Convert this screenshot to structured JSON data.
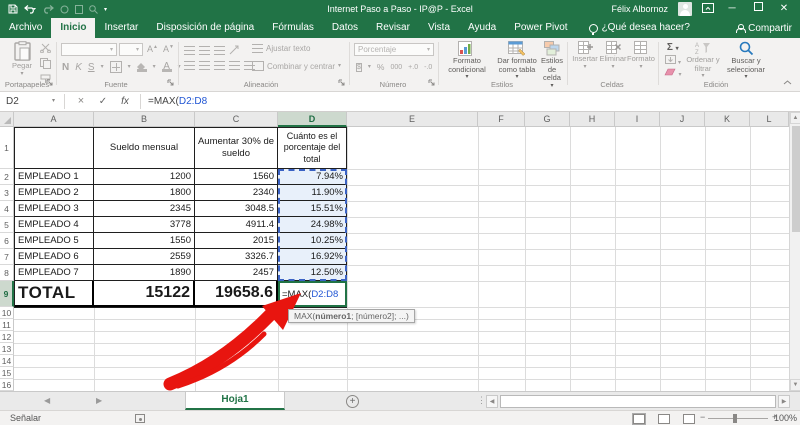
{
  "titlebar": {
    "title": "Internet Paso a Paso - IP@P - Excel",
    "user_name": "Félix Albornoz"
  },
  "tabs": [
    {
      "label": "Archivo",
      "active": false
    },
    {
      "label": "Inicio",
      "active": true
    },
    {
      "label": "Insertar",
      "active": false
    },
    {
      "label": "Disposición de página",
      "active": false
    },
    {
      "label": "Fórmulas",
      "active": false
    },
    {
      "label": "Datos",
      "active": false
    },
    {
      "label": "Revisar",
      "active": false
    },
    {
      "label": "Vista",
      "active": false
    },
    {
      "label": "Ayuda",
      "active": false
    },
    {
      "label": "Power Pivot",
      "active": false
    }
  ],
  "tellme": "¿Qué desea hacer?",
  "share_label": "Compartir",
  "ribbon": {
    "portapapeles": {
      "paste": "Pegar",
      "label": "Portapapeles"
    },
    "fuente": {
      "bold": "N",
      "italic": "K",
      "underline": "S",
      "label": "Fuente"
    },
    "alineacion": {
      "wrap": "Ajustar texto",
      "merge": "Combinar y centrar",
      "label": "Alineación"
    },
    "numero": {
      "format": "Porcentaje",
      "currency": "$",
      "percent": "%",
      "thousands": "000",
      "dec_inc": "+.0",
      "dec_dec": "-.0",
      "label": "Número"
    },
    "estilos": {
      "conditional": "Formato condicional",
      "as_table": "Dar formato como tabla",
      "cell_styles": "Estilos de celda",
      "label": "Estilos"
    },
    "celdas": {
      "insert": "Insertar",
      "remove": "Eliminar",
      "format": "Formato",
      "label": "Celdas"
    },
    "edicion": {
      "sum": "Σ",
      "sort": "Ordenar y filtrar",
      "find": "Buscar y seleccionar",
      "label": "Edición"
    }
  },
  "formula_bar": {
    "name_box": "D2",
    "cancel": "×",
    "enter": "✓",
    "fx": "fx",
    "formula_prefix": "=MAX(",
    "formula_ref": "D2:D8"
  },
  "sheet": {
    "col_headers": [
      "A",
      "B",
      "C",
      "D",
      "E",
      "F",
      "G",
      "H",
      "I",
      "J",
      "K",
      "L"
    ],
    "active_col": "D",
    "row_count": 16,
    "active_row": 9,
    "headers": [
      "Sueldo mensual",
      "Aumentar 30% de sueldo",
      "Cuánto es el porcentaje del total"
    ],
    "employees": [
      {
        "name": "EMPLEADO 1",
        "sueldo": "1200",
        "aumento": "1560",
        "pct": "7.94%"
      },
      {
        "name": "EMPLEADO 2",
        "sueldo": "1800",
        "aumento": "2340",
        "pct": "11.90%"
      },
      {
        "name": "EMPLEADO 3",
        "sueldo": "2345",
        "aumento": "3048.5",
        "pct": "15.51%"
      },
      {
        "name": "EMPLEADO 4",
        "sueldo": "3778",
        "aumento": "4911.4",
        "pct": "24.98%"
      },
      {
        "name": "EMPLEADO 5",
        "sueldo": "1550",
        "aumento": "2015",
        "pct": "10.25%"
      },
      {
        "name": "EMPLEADO 6",
        "sueldo": "2559",
        "aumento": "3326.7",
        "pct": "16.92%"
      },
      {
        "name": "EMPLEADO 7",
        "sueldo": "1890",
        "aumento": "2457",
        "pct": "12.50%"
      }
    ],
    "total": {
      "label": "TOTAL",
      "sueldo": "15122",
      "aumento": "19658.6"
    },
    "active_cell_formula": {
      "prefix": "=MAX(",
      "ref": "D2:D8"
    },
    "tooltip": {
      "pre": "MAX(",
      "bold": "número1",
      "post": "; [número2]; ...)"
    }
  },
  "sheet_bar": {
    "tab": "Hoja1"
  },
  "status_bar": {
    "mode": "Señalar",
    "zoom": "100%"
  },
  "colors": {
    "excel_green": "#217346",
    "reference_blue": "#2156d4",
    "range_fill": "#e8f0fa",
    "arrow_red": "#e8150f"
  }
}
